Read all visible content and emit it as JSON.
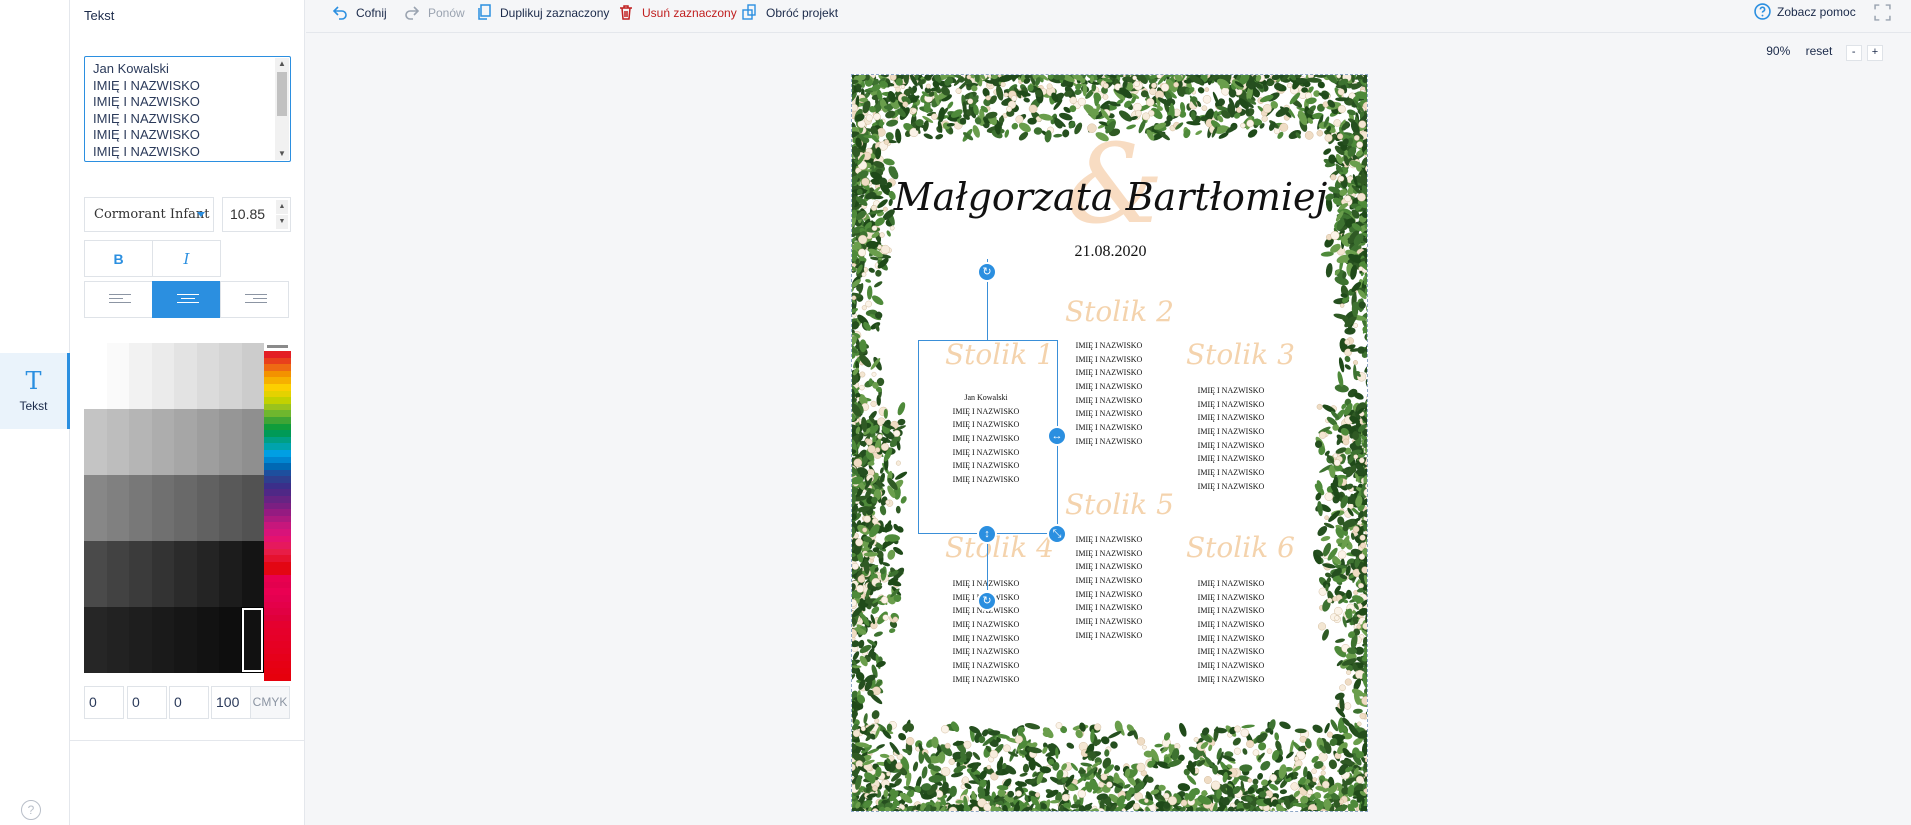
{
  "rail": {
    "tool_glyph": "T",
    "tool_label": "Tekst",
    "help_glyph": "?"
  },
  "panel": {
    "heading": "Tekst",
    "text_lines": [
      "Jan Kowalski",
      "IMIĘ I NAZWISKO",
      "IMIĘ I NAZWISKO",
      "IMIĘ I NAZWISKO",
      "IMIĘ I NAZWISKO",
      "IMIĘ I NAZWISKO"
    ],
    "font_family": "Cormorant Infant",
    "font_size": "10.85",
    "bold_label": "B",
    "italic_label": "I",
    "alignment": "center",
    "cmyk": {
      "c": "0",
      "m": "0",
      "y": "0",
      "k": "100",
      "label": "CMYK"
    },
    "selected_color": "#111111"
  },
  "toolbar": {
    "undo": "Cofnij",
    "redo": "Ponów",
    "duplicate": "Duplikuj zaznaczony",
    "delete": "Usuń zaznaczony",
    "rotate_project": "Obróć projekt",
    "help": "Zobacz pomoc"
  },
  "zoom": {
    "level": "90%",
    "reset": "reset",
    "minus": "-",
    "plus": "+"
  },
  "canvas": {
    "names_title": "Małgorzata Bartłomiej",
    "ampersand": "&",
    "date": "21.08.2020",
    "tables": [
      {
        "title": "Stolik 1",
        "guests": [
          "Jan Kowalski",
          "IMIĘ I NAZWISKO",
          "IMIĘ I NAZWISKO",
          "IMIĘ I NAZWISKO",
          "IMIĘ I NAZWISKO",
          "IMIĘ I NAZWISKO",
          "IMIĘ I NAZWISKO"
        ]
      },
      {
        "title": "Stolik 2",
        "guests": [
          "IMIĘ I NAZWISKO",
          "IMIĘ I NAZWISKO",
          "IMIĘ I NAZWISKO",
          "IMIĘ I NAZWISKO",
          "IMIĘ I NAZWISKO",
          "IMIĘ I NAZWISKO",
          "IMIĘ I NAZWISKO",
          "IMIĘ I NAZWISKO"
        ]
      },
      {
        "title": "Stolik 3",
        "guests": [
          "IMIĘ I NAZWISKO",
          "IMIĘ I NAZWISKO",
          "IMIĘ I NAZWISKO",
          "IMIĘ I NAZWISKO",
          "IMIĘ I NAZWISKO",
          "IMIĘ I NAZWISKO",
          "IMIĘ I NAZWISKO",
          "IMIĘ I NAZWISKO"
        ]
      },
      {
        "title": "Stolik 4",
        "guests": [
          "IMIĘ I NAZWISKO",
          "IMIĘ I NAZWISKO",
          "IMIĘ I NAZWISKO",
          "IMIĘ I NAZWISKO",
          "IMIĘ I NAZWISKO",
          "IMIĘ I NAZWISKO",
          "IMIĘ I NAZWISKO",
          "IMIĘ I NAZWISKO"
        ]
      },
      {
        "title": "Stolik 5",
        "guests": [
          "IMIĘ I NAZWISKO",
          "IMIĘ I NAZWISKO",
          "IMIĘ I NAZWISKO",
          "IMIĘ I NAZWISKO",
          "IMIĘ I NAZWISKO",
          "IMIĘ I NAZWISKO",
          "IMIĘ I NAZWISKO",
          "IMIĘ I NAZWISKO"
        ]
      },
      {
        "title": "Stolik 6",
        "guests": [
          "IMIĘ I NAZWISKO",
          "IMIĘ I NAZWISKO",
          "IMIĘ I NAZWISKO",
          "IMIĘ I NAZWISKO",
          "IMIĘ I NAZWISKO",
          "IMIĘ I NAZWISKO",
          "IMIĘ I NAZWISKO",
          "IMIĘ I NAZWISKO"
        ]
      }
    ]
  },
  "colors": {
    "accent": "#2b8fe0",
    "danger": "#c01f1f",
    "table_title": "#f4d3ad",
    "foliage": "#2f5a24",
    "blossom": "#f3e6d2"
  }
}
